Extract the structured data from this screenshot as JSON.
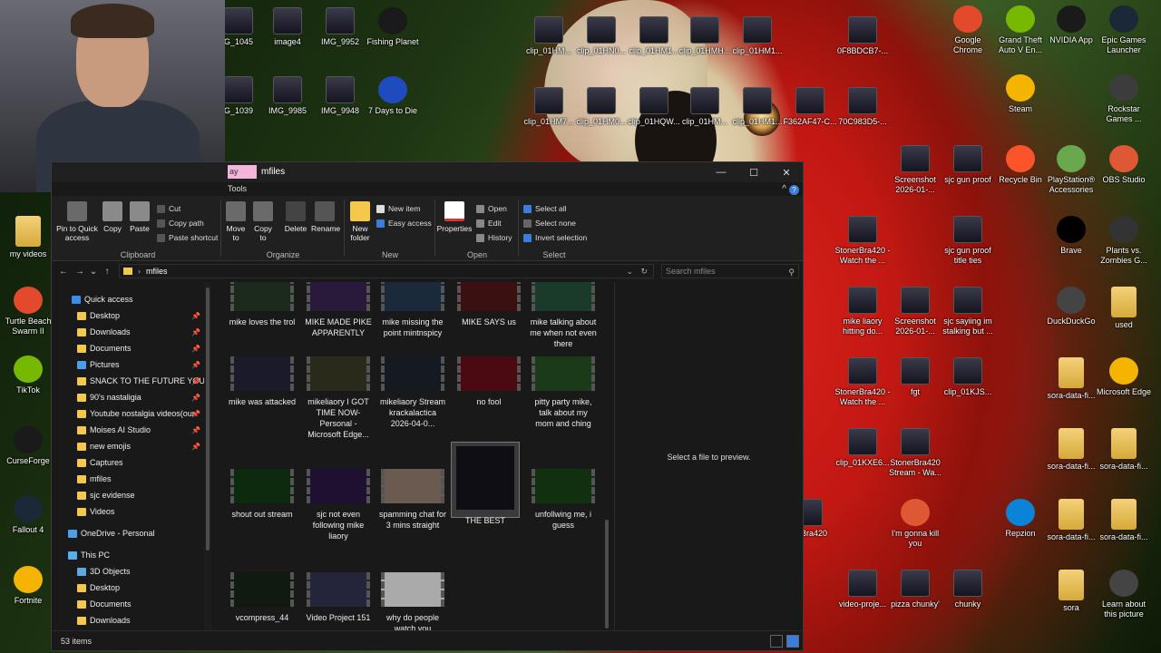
{
  "desktop_icons": [
    {
      "label": "G_1045",
      "kind": "thumb"
    },
    {
      "label": "image4",
      "kind": "thumb"
    },
    {
      "label": "IMG_9952",
      "kind": "thumb"
    },
    {
      "label": "Fishing Planet",
      "kind": "app"
    },
    {
      "label": "G_1039",
      "kind": "thumb"
    },
    {
      "label": "IMG_9985",
      "kind": "thumb"
    },
    {
      "label": "IMG_9948",
      "kind": "thumb"
    },
    {
      "label": "7 Days to Die",
      "kind": "app"
    },
    {
      "label": "clip_01HM...",
      "kind": "thumb"
    },
    {
      "label": "clip_01HN0...",
      "kind": "thumb"
    },
    {
      "label": "clip_01HM1...",
      "kind": "thumb"
    },
    {
      "label": "clip_01HMH...",
      "kind": "thumb"
    },
    {
      "label": "clip_01HM1...",
      "kind": "thumb"
    },
    {
      "label": "0F8BDCB7-...",
      "kind": "thumb"
    },
    {
      "label": "clip_01HM7...",
      "kind": "thumb"
    },
    {
      "label": "clip_01HM0...",
      "kind": "thumb"
    },
    {
      "label": "clip_01HQW...",
      "kind": "thumb"
    },
    {
      "label": "clip_01HM...",
      "kind": "thumb"
    },
    {
      "label": "clip_01HM1...",
      "kind": "thumb"
    },
    {
      "label": "F362AF47-C...",
      "kind": "thumb"
    },
    {
      "label": "70C983D5-...",
      "kind": "thumb"
    },
    {
      "label": "Google Chrome",
      "kind": "app"
    },
    {
      "label": "Grand Theft Auto V En...",
      "kind": "app"
    },
    {
      "label": "NVIDIA App",
      "kind": "app"
    },
    {
      "label": "Epic Games Launcher",
      "kind": "app"
    },
    {
      "label": "Steam",
      "kind": "app"
    },
    {
      "label": "Rockstar Games ...",
      "kind": "app"
    },
    {
      "label": "Screenshot 2026-01-...",
      "kind": "thumb"
    },
    {
      "label": "sjc gun proof",
      "kind": "thumb"
    },
    {
      "label": "Recycle Bin",
      "kind": "app"
    },
    {
      "label": "PlayStation® Accessories",
      "kind": "app"
    },
    {
      "label": "OBS Studio",
      "kind": "app"
    },
    {
      "label": "StonerBra420 - Watch the ...",
      "kind": "thumb"
    },
    {
      "label": "sjc gun proof title ties",
      "kind": "thumb"
    },
    {
      "label": "Brave",
      "kind": "app"
    },
    {
      "label": "Plants vs. Zombies G...",
      "kind": "app"
    },
    {
      "label": "mike liaory hitting do...",
      "kind": "thumb"
    },
    {
      "label": "Screenshot 2026-01-...",
      "kind": "thumb"
    },
    {
      "label": "sjc sayiing im stalking but ...",
      "kind": "thumb"
    },
    {
      "label": "DuckDuckGo",
      "kind": "app"
    },
    {
      "label": "used",
      "kind": "folder"
    },
    {
      "label": "StonerBra420 - Watch the ...",
      "kind": "thumb"
    },
    {
      "label": "fgt",
      "kind": "thumb"
    },
    {
      "label": "clip_01KJS...",
      "kind": "thumb"
    },
    {
      "label": "sora-data-fi...",
      "kind": "folder"
    },
    {
      "label": "Microsoft Edge",
      "kind": "app"
    },
    {
      "label": "clip_01KXE6...",
      "kind": "thumb"
    },
    {
      "label": "StonerBra420 Stream - Wa...",
      "kind": "thumb"
    },
    {
      "label": "sora-data-fi...",
      "kind": "folder"
    },
    {
      "label": "sora-data-fi...",
      "kind": "folder"
    },
    {
      "label": "nerBra420",
      "kind": "thumb"
    },
    {
      "label": "I'm gonna kill you",
      "kind": "app"
    },
    {
      "label": "Repzion",
      "kind": "app"
    },
    {
      "label": "sora-data-fi...",
      "kind": "folder"
    },
    {
      "label": "sora-data-fi...",
      "kind": "folder"
    },
    {
      "label": "video-proje...",
      "kind": "thumb"
    },
    {
      "label": "pizza chunky'",
      "kind": "thumb"
    },
    {
      "label": "chunky",
      "kind": "thumb"
    },
    {
      "label": "sora",
      "kind": "folder"
    },
    {
      "label": "Learn about this picture",
      "kind": "app"
    },
    {
      "label": "my videos",
      "kind": "folder"
    },
    {
      "label": "Turtle Beach Swarm II",
      "kind": "app"
    },
    {
      "label": "TikTok",
      "kind": "app"
    },
    {
      "label": "CurseForge",
      "kind": "app"
    },
    {
      "label": "Fallout 4",
      "kind": "app"
    },
    {
      "label": "Fortnite",
      "kind": "app"
    }
  ],
  "window": {
    "tab_fragment": "ay",
    "title": "mfiles",
    "tools_label": "Tools",
    "minimize": "—",
    "maximize": "☐",
    "close": "✕",
    "help": "?",
    "collapse": "^"
  },
  "ribbon": {
    "clipboard": {
      "group": "Clipboard",
      "pin": "Pin to Quick access",
      "copy": "Copy",
      "paste": "Paste",
      "cut": "Cut",
      "copy_path": "Copy path",
      "paste_shortcut": "Paste shortcut"
    },
    "organize": {
      "group": "Organize",
      "move_to": "Move to",
      "copy_to": "Copy to",
      "delete": "Delete",
      "rename": "Rename"
    },
    "new": {
      "group": "New",
      "new_folder": "New folder",
      "new_item": "New item",
      "easy_access": "Easy access"
    },
    "open": {
      "group": "Open",
      "properties": "Properties",
      "open": "Open",
      "edit": "Edit",
      "history": "History"
    },
    "select": {
      "group": "Select",
      "select_all": "Select all",
      "select_none": "Select none",
      "invert": "Invert selection"
    }
  },
  "address": {
    "path": "mfiles",
    "search_placeholder": "Search mfiles",
    "back": "←",
    "forward": "→",
    "recent": "⌄",
    "up": "↑",
    "sep": "›",
    "dropdown": "⌄",
    "refresh": "↻",
    "search_icon": "⚲"
  },
  "nav": {
    "quick_access": "Quick access",
    "items": [
      {
        "label": "Desktop",
        "pinned": true
      },
      {
        "label": "Downloads",
        "pinned": true
      },
      {
        "label": "Documents",
        "pinned": true
      },
      {
        "label": "Pictures",
        "pinned": true
      },
      {
        "label": "SNACK TO THE FUTURE YOUT",
        "pinned": true
      },
      {
        "label": "90's nastaligia",
        "pinned": true
      },
      {
        "label": "Youtube nostalgia videos(our",
        "pinned": true
      },
      {
        "label": "Moises AI Studio",
        "pinned": true
      },
      {
        "label": "new emojis",
        "pinned": true
      },
      {
        "label": "Captures",
        "pinned": false
      },
      {
        "label": "mfiles",
        "pinned": false
      },
      {
        "label": "sjc evidense",
        "pinned": false
      },
      {
        "label": "Videos",
        "pinned": false
      }
    ],
    "onedrive": "OneDrive - Personal",
    "this_pc": "This PC",
    "pc_items": [
      "3D Objects",
      "Desktop",
      "Documents",
      "Downloads"
    ]
  },
  "files": [
    {
      "name": "mike loves the trol"
    },
    {
      "name": "MIKE MADE PIKE APPARENTLY"
    },
    {
      "name": "mike missing the point mintnspicy"
    },
    {
      "name": "MIKE SAYS us"
    },
    {
      "name": "mike talking about me when not even there"
    },
    {
      "name": "mike was attacked"
    },
    {
      "name": "mikeliaory I GOT TIME NOW- Personal - Microsoft Edge..."
    },
    {
      "name": "mikeliaory Stream krackalactica 2026-04-0..."
    },
    {
      "name": "no fool"
    },
    {
      "name": "pitty party mike, talk about my mom and ching"
    },
    {
      "name": "shout out stream"
    },
    {
      "name": "sjc not even following mike liaory"
    },
    {
      "name": "spamming chat for 3 mins straight"
    },
    {
      "name": "THE BEST",
      "selected": true
    },
    {
      "name": "unfollwing me, i guess"
    },
    {
      "name": "vcompress_44"
    },
    {
      "name": "Video Project 151"
    },
    {
      "name": "why do people watch you"
    }
  ],
  "preview": {
    "message": "Select a file to preview."
  },
  "status": {
    "count": "53 items"
  }
}
